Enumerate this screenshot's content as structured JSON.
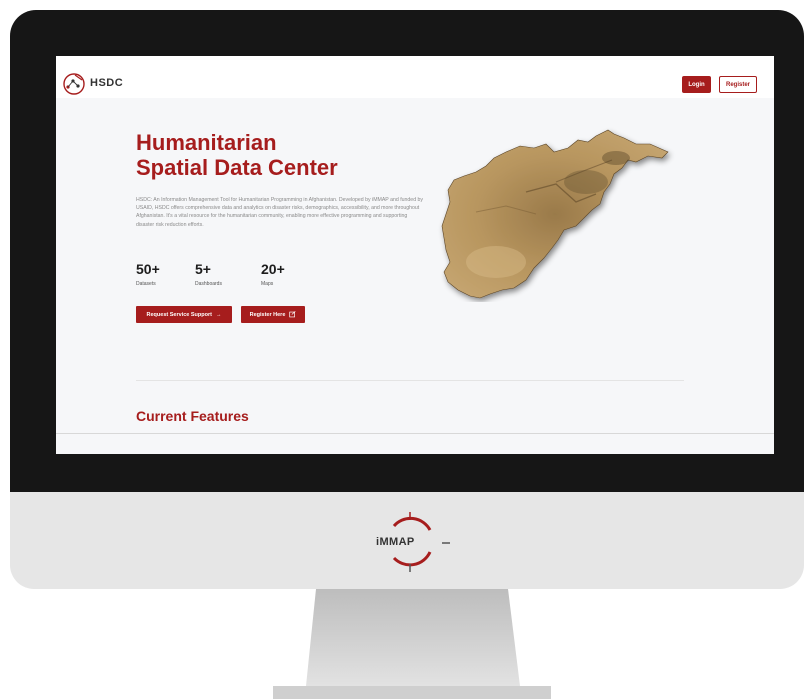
{
  "navbar": {
    "logo_text": "HSDC",
    "login_label": "Login",
    "register_label": "Register"
  },
  "hero": {
    "title_line1": "Humanitarian",
    "title_line2": "Spatial Data Center",
    "description": "HSDC: An Information Management Tool for Humanitarian Programming in Afghanistan. Developed by iMMAP and funded by USAID, HSDC offers comprehensive data and analytics on disaster risks, demographics, accessibility, and more throughout Afghanistan. It's a vital resource for the humanitarian community, enabling more effective programming and supporting disaster risk reduction efforts.",
    "stats": [
      {
        "value": "50+",
        "label": "Datasets"
      },
      {
        "value": "5+",
        "label": "Dashboards"
      },
      {
        "value": "20+",
        "label": "Maps"
      }
    ],
    "request_button": "Request Service Support",
    "register_button": "Register Here"
  },
  "features": {
    "title": "Current Features"
  },
  "monitor": {
    "brand": "iMMAP"
  },
  "colors": {
    "accent": "#a61d1d",
    "frame": "#161616",
    "chin": "#e6e6e6"
  },
  "icons": {
    "request_arrow": "arrow-right-icon",
    "register_icon": "register-icon",
    "logo": "hsdc-logo-icon"
  }
}
